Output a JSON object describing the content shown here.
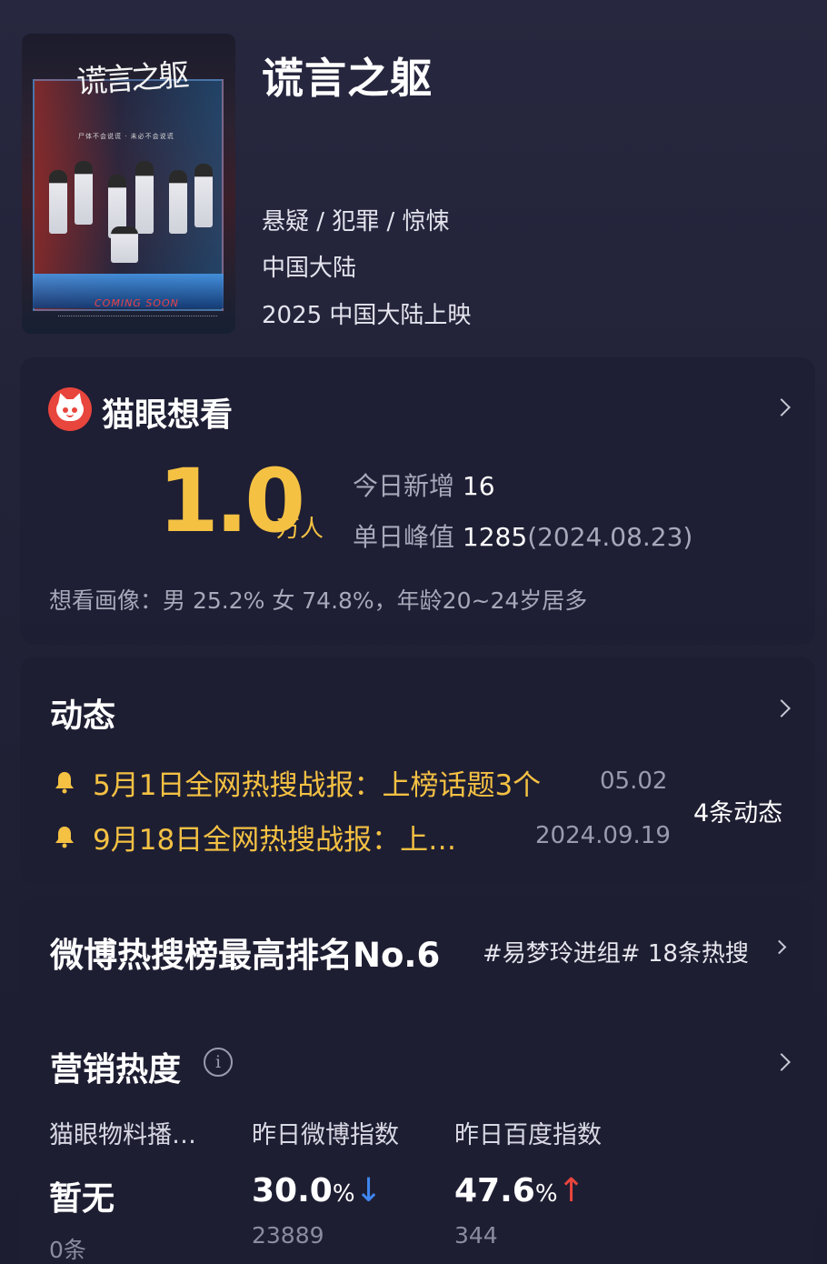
{
  "movie": {
    "title": "谎言之躯",
    "genres": "悬疑 / 犯罪 / 惊悚",
    "region": "中国大陆",
    "release": "2025 中国大陆上映",
    "poster": {
      "title_text": "谎言之躯",
      "tagline": "尸体不会说谎 · 未必不会说谎",
      "coming_text": "COMING SOON"
    }
  },
  "want_to_see": {
    "title": "猫眼想看",
    "number": "1.0",
    "unit": "万人",
    "today_label": "今日新增",
    "today_value": "16",
    "peak_label": "单日峰值",
    "peak_value": "1285",
    "peak_date": "(2024.08.23)",
    "portrait": "想看画像：男 25.2%  女 74.8%，年龄20~24岁居多"
  },
  "news": {
    "title": "动态",
    "items": [
      {
        "text": "5月1日全网热搜战报：上榜话题3个",
        "date": "05.02"
      },
      {
        "text": "9月18日全网热搜战报：上…",
        "date": "2024.09.19"
      }
    ],
    "count": "4条动态"
  },
  "weibo": {
    "title": "微博热搜榜最高排名No.6",
    "topic": "#易梦玲进组# 18条热搜"
  },
  "marketing": {
    "title": "营销热度",
    "info": "i",
    "metrics": [
      {
        "label": "猫眼物料播…",
        "value": "暂无",
        "pct": "",
        "arrow": "",
        "sub": "0条"
      },
      {
        "label": "昨日微博指数",
        "value": "30.0",
        "pct": "%",
        "arrow": "↓",
        "sub": "23889"
      },
      {
        "label": "昨日百度指数",
        "value": "47.6",
        "pct": "%",
        "arrow": "↑",
        "sub": "344"
      }
    ]
  },
  "colors": {
    "accent_gold": "#f4c143",
    "logo_red": "#e8453c",
    "down_blue": "#3f86f0",
    "up_red": "#e8453c"
  }
}
